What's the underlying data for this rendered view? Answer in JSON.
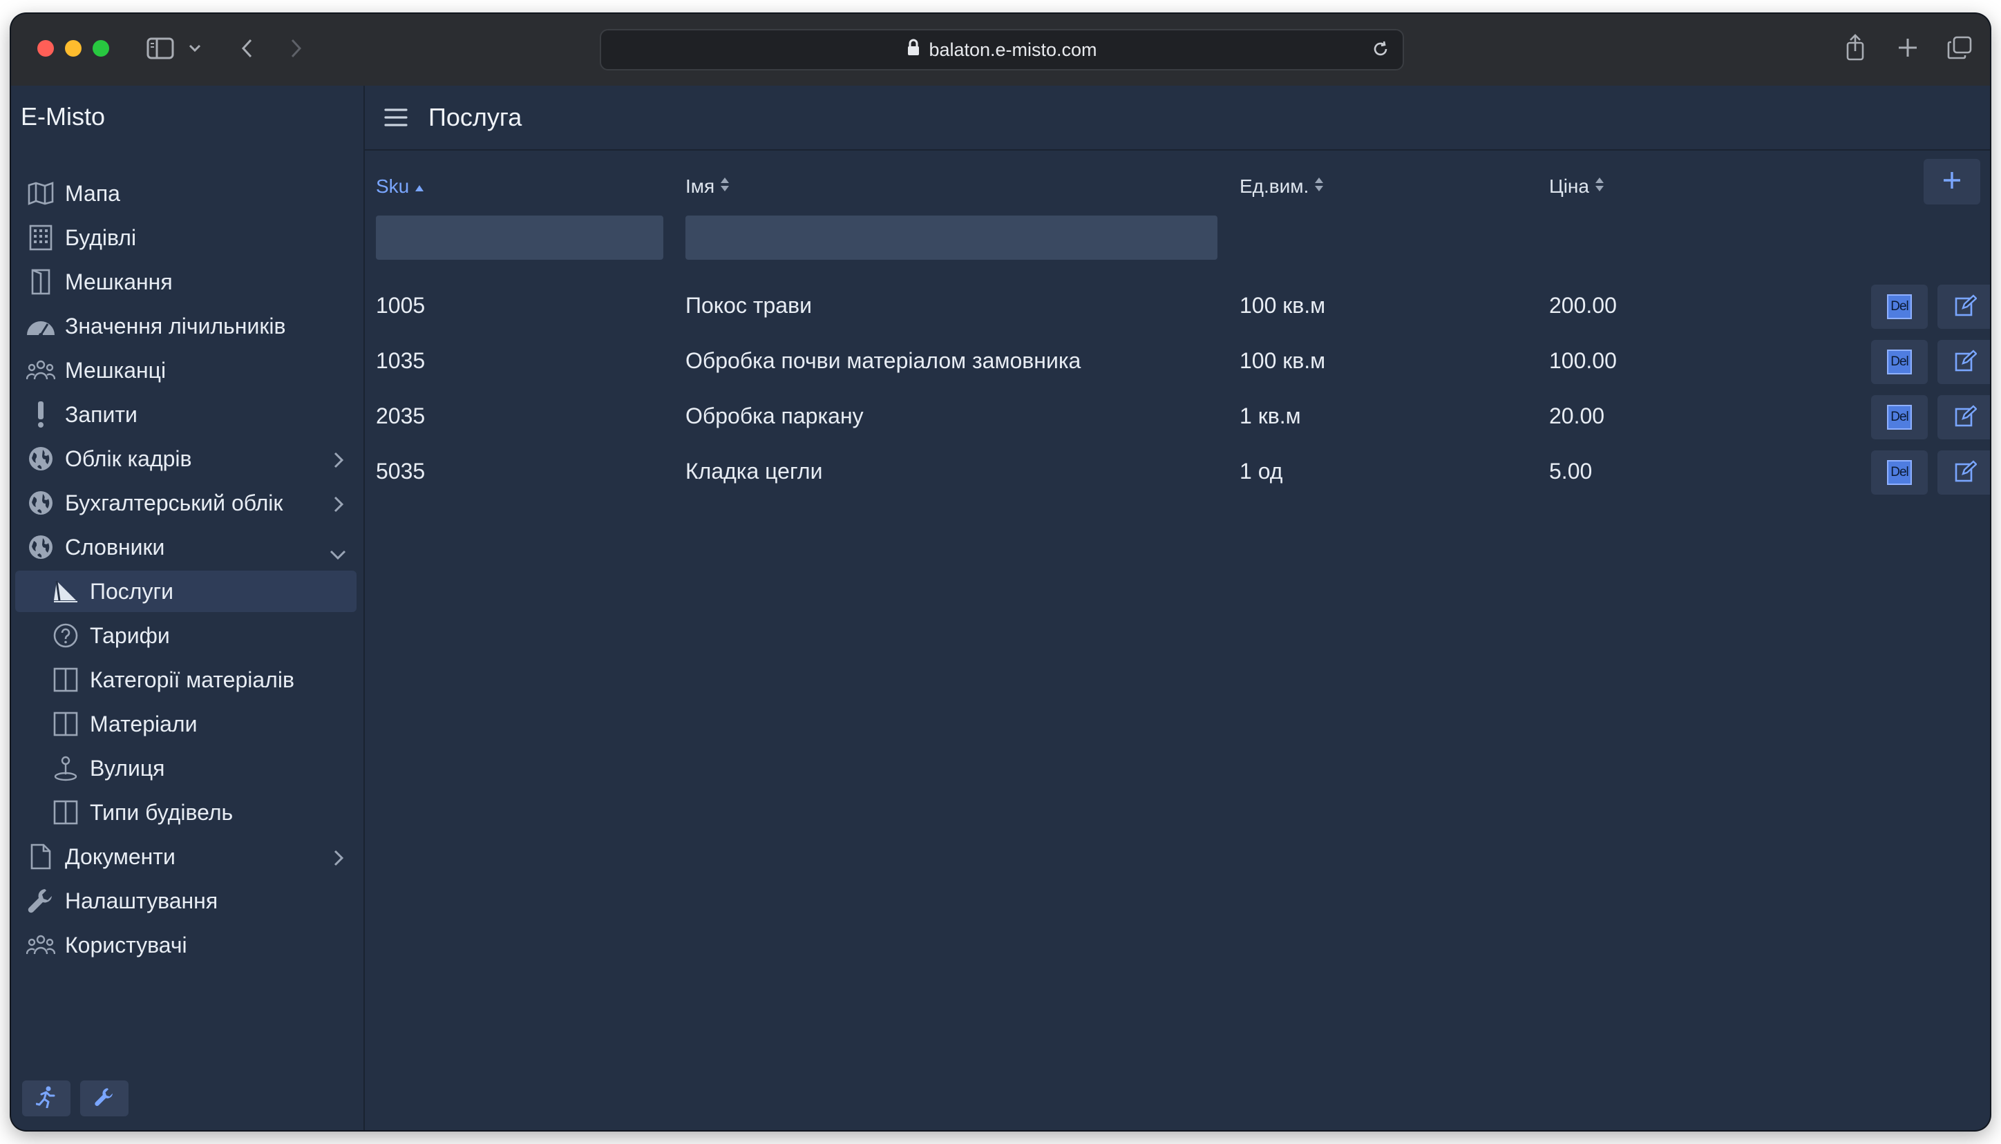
{
  "browser": {
    "url": "balaton.e-misto.com"
  },
  "sidebar": {
    "brand": "E-Misto",
    "items": [
      {
        "label": "Мапа",
        "icon": "map-icon"
      },
      {
        "label": "Будівлі",
        "icon": "building-icon"
      },
      {
        "label": "Мешкання",
        "icon": "door-icon"
      },
      {
        "label": "Значення лічильників",
        "icon": "gauge-icon"
      },
      {
        "label": "Мешканці",
        "icon": "people-icon"
      },
      {
        "label": "Запити",
        "icon": "exclamation-icon"
      },
      {
        "label": "Облік кадрів",
        "icon": "globe-icon",
        "expandable": true
      },
      {
        "label": "Бухгалтерський облік",
        "icon": "globe-icon",
        "expandable": true
      },
      {
        "label": "Словники",
        "icon": "globe-icon",
        "expanded": true
      }
    ],
    "sub_items": [
      {
        "label": "Послуги",
        "icon": "sail-icon",
        "active": true
      },
      {
        "label": "Тарифи",
        "icon": "question-circle-icon"
      },
      {
        "label": "Категорії матеріалів",
        "icon": "columns-icon"
      },
      {
        "label": "Матеріали",
        "icon": "columns-icon"
      },
      {
        "label": "Вулиця",
        "icon": "street-icon"
      },
      {
        "label": "Типи будівель",
        "icon": "columns-icon"
      }
    ],
    "bottom_items": [
      {
        "label": "Документи",
        "icon": "document-icon",
        "expandable": true
      },
      {
        "label": "Налаштування",
        "icon": "wrench-icon"
      },
      {
        "label": "Користувачі",
        "icon": "people-icon"
      }
    ]
  },
  "main": {
    "title": "Послуга",
    "columns": [
      {
        "label": "Sku",
        "sort": "asc"
      },
      {
        "label": "Імя",
        "sort": "none"
      },
      {
        "label": "Ед.вим.",
        "sort": "none"
      },
      {
        "label": "Ціна",
        "sort": "none"
      }
    ],
    "filters": {
      "sku": "",
      "name": ""
    },
    "rows": [
      {
        "sku": "1005",
        "name": "Покос трави",
        "unit": "100 кв.м",
        "price": "200.00"
      },
      {
        "sku": "1035",
        "name": "Обробка почви матеріалом замовника",
        "unit": "100 кв.м",
        "price": "100.00"
      },
      {
        "sku": "2035",
        "name": "Обробка паркану",
        "unit": "1 кв.м",
        "price": "20.00"
      },
      {
        "sku": "5035",
        "name": "Кладка цегли",
        "unit": "1 од",
        "price": "5.00"
      }
    ],
    "delete_label": "Del"
  },
  "colors": {
    "background": "#243044",
    "accent": "#7aa6ff",
    "active_item": "#2f3d58"
  }
}
